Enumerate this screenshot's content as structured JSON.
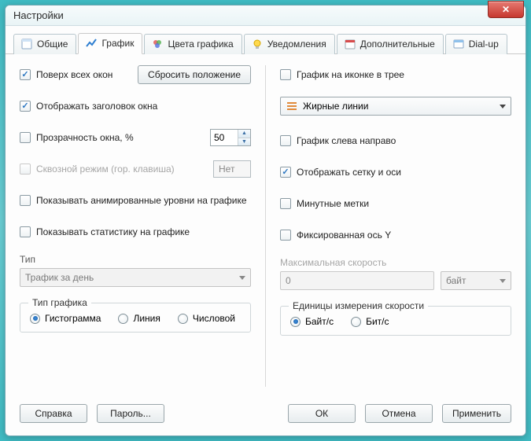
{
  "window": {
    "title": "Настройки"
  },
  "tabs": [
    {
      "id": "general",
      "label": "Общие"
    },
    {
      "id": "graph",
      "label": "График"
    },
    {
      "id": "colors",
      "label": "Цвета графика"
    },
    {
      "id": "notify",
      "label": "Уведомления"
    },
    {
      "id": "extra",
      "label": "Дополнительные"
    },
    {
      "id": "dialup",
      "label": "Dial-up"
    }
  ],
  "left": {
    "always_on_top": "Поверх всех окон",
    "reset_position": "Сбросить положение",
    "show_caption": "Отображать заголовок окна",
    "opacity_label": "Прозрачность окна, %",
    "opacity_value": "50",
    "clickthrough": "Сквозной режим (гор. клавиша)",
    "clickthrough_value": "Нет",
    "show_anim_levels": "Показывать анимированные уровни на графике",
    "show_stats": "Показывать статистику на графике",
    "type_label": "Тип",
    "type_value": "Трафик за день",
    "chart_type_group": "Тип графика",
    "radio_bar": "Гистограмма",
    "radio_line": "Линия",
    "radio_num": "Числовой"
  },
  "right": {
    "tray_graph": "График на иконке в трее",
    "line_style_value": "Жирные линии",
    "ltr": "График слева направо",
    "grid_axes": "Отображать сетку и оси",
    "minute_marks": "Минутные метки",
    "fixed_y": "Фиксированная ось Y",
    "max_speed_label": "Максимальная скорость",
    "max_speed_value": "0",
    "max_speed_unit": "байт",
    "speed_units_group": "Единицы измерения скорости",
    "radio_bytes": "Байт/с",
    "radio_bits": "Бит/с"
  },
  "footer": {
    "help": "Справка",
    "password": "Пароль...",
    "ok": "ОК",
    "cancel": "Отмена",
    "apply": "Применить"
  }
}
